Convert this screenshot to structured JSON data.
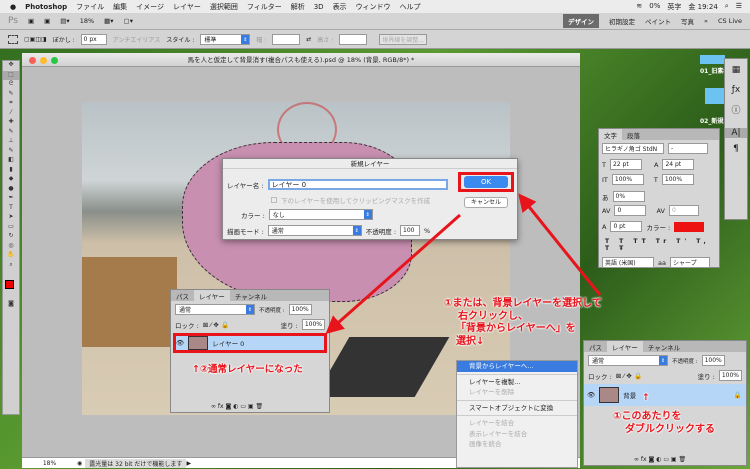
{
  "menubar": {
    "apple": "",
    "app": "Photoshop",
    "items": [
      "ファイル",
      "編集",
      "イメージ",
      "レイヤー",
      "選択範囲",
      "フィルター",
      "解析",
      "3D",
      "表示",
      "ウィンドウ",
      "ヘルプ"
    ],
    "status": [
      "0%",
      "英字",
      "金 19:24"
    ]
  },
  "appbar": {
    "logo": "Ps",
    "zoom": "18%",
    "workspaces": [
      "デザイン",
      "初期設定",
      "ペイント",
      "写真"
    ],
    "more": "»",
    "cslive": "CS Live"
  },
  "options": {
    "feather_label": "ぼかし :",
    "feather_value": "0 px",
    "antialias": "アンチエイリアス",
    "style_label": "スタイル :",
    "style_value": "標準",
    "width_label": "幅 :",
    "height_label": "高さ :",
    "refine": "境界線を調整..."
  },
  "document": {
    "title": "馬を人と仮定して背景消す(複合パスも使える).psd @ 18% (背景, RGB/8*) *",
    "zoom": "18%",
    "status": "露光量は 32 bit だけで機能します"
  },
  "dialog": {
    "title": "新規レイヤー",
    "name_label": "レイヤー名 :",
    "name_value": "レイヤー 0",
    "clip_label": "下のレイヤーを使用してクリッピングマスクを作成",
    "color_label": "カラー :",
    "color_value": "なし",
    "mode_label": "描画モード :",
    "mode_value": "通常",
    "opacity_label": "不透明度 :",
    "opacity_value": "100",
    "percent": "%",
    "ok": "OK",
    "cancel": "キャンセル"
  },
  "layers_left": {
    "tabs": [
      "パス",
      "レイヤー",
      "チャンネル"
    ],
    "mode": "通常",
    "opacity_label": "不透明度 :",
    "opacity": "100%",
    "lock_label": "ロック :",
    "fill_label": "塗り :",
    "fill": "100%",
    "layer_name": "レイヤー 0"
  },
  "layers_right": {
    "tabs": [
      "パス",
      "レイヤー",
      "チャンネル"
    ],
    "mode": "通常",
    "opacity_label": "不透明度 :",
    "opacity": "100%",
    "lock_label": "ロック :",
    "fill_label": "塗り :",
    "fill": "100%",
    "layer_name": "背景"
  },
  "context_menu": {
    "items": [
      {
        "label": "背景からレイヤーへ...",
        "state": "highlight"
      },
      {
        "label": "レイヤーを複製...",
        "state": "normal"
      },
      {
        "label": "レイヤーを削除",
        "state": "disabled"
      },
      {
        "label": "スマートオブジェクトに変換",
        "state": "normal"
      },
      {
        "label": "レイヤーを結合",
        "state": "disabled"
      },
      {
        "label": "表示レイヤーを結合",
        "state": "disabled"
      },
      {
        "label": "画像を統合",
        "state": "disabled"
      }
    ]
  },
  "character": {
    "tabs": [
      "文字",
      "段落"
    ],
    "font": "ヒラギノ角ゴ StdN",
    "style": "-",
    "size": "22 pt",
    "leading": "24 pt",
    "vscale": "100%",
    "hscale": "100%",
    "tsume": "0%",
    "tracking": "0",
    "kerning": "0",
    "baseline": "0 pt",
    "color_label": "カラー :",
    "color": "#ee1111",
    "language": "英語 (米国)",
    "aa": "シャープ"
  },
  "desktop": {
    "files": [
      "01_旧素材",
      "02_新規素材"
    ]
  },
  "annotations": {
    "right_click": [
      "①または、背景レイヤーを選択して",
      "右クリックし、",
      "「背景からレイヤーへ」を",
      "選択↓"
    ],
    "double_click": [
      "①このあたりを",
      "ダブルクリックする"
    ],
    "result": "↑②通常レイヤーになった",
    "arrow_up": "↑"
  },
  "colors": {
    "accent": "#e8141c",
    "selection": "#b6d6f8"
  }
}
